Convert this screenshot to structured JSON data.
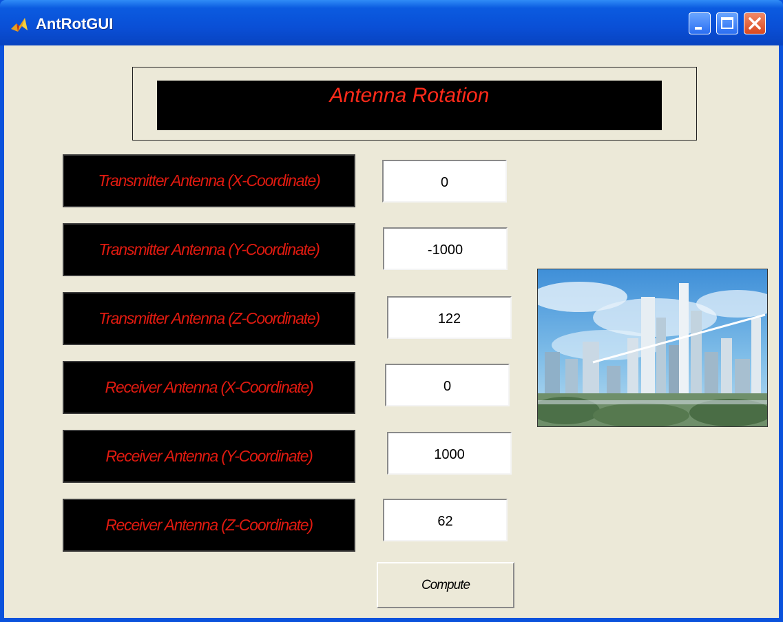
{
  "window": {
    "title": "AntRotGUI"
  },
  "header": {
    "title": "Antenna Rotation"
  },
  "rows": [
    {
      "label": "Transmitter Antenna (X-Coordinate)",
      "value": "0"
    },
    {
      "label": "Transmitter Antenna (Y-Coordinate)",
      "value": "-1000"
    },
    {
      "label": "Transmitter Antenna (Z-Coordinate)",
      "value": "122"
    },
    {
      "label": "Receiver Antenna (X-Coordinate)",
      "value": "0"
    },
    {
      "label": "Receiver Antenna (Y-Coordinate)",
      "value": "1000"
    },
    {
      "label": "Receiver Antenna (Z-Coordinate)",
      "value": "62"
    }
  ],
  "actions": {
    "compute_label": "Compute"
  },
  "icons": {
    "app": "matlab-icon",
    "minimize": "minimize-icon",
    "maximize": "maximize-icon",
    "close": "close-icon"
  },
  "colors": {
    "label_text": "#e01a10",
    "title_text": "#ff2a1a",
    "panel_bg": "#ece9d8",
    "titlebar": "#0a52dc"
  }
}
